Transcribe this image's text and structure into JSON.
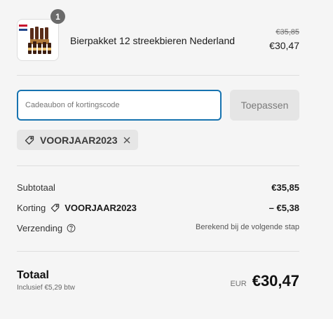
{
  "line_item": {
    "quantity": "1",
    "name": "Bierpakket 12 streekbieren Nederland",
    "original_price": "€35,85",
    "price": "€30,47",
    "thumbnail_icon": "beer-bottles-icon"
  },
  "discount": {
    "placeholder": "Cadeaubon of kortingscode",
    "apply_label": "Toepassen",
    "applied_code": "VOORJAAR2023",
    "tag_icon": "tag-icon",
    "remove_icon": "close-icon"
  },
  "summary": {
    "subtotal_label": "Subtotaal",
    "subtotal_value": "€35,85",
    "discount_label": "Korting",
    "discount_code": "VOORJAAR2023",
    "discount_value": "– €5,38",
    "shipping_label": "Verzending",
    "shipping_value": "Berekend bij de volgende stap",
    "shipping_icon": "help-circle-icon"
  },
  "total": {
    "label": "Totaal",
    "tax_note": "Inclusief €5,29 btw",
    "currency": "EUR",
    "amount": "€30,47"
  },
  "colors": {
    "focus_border": "#1773b0",
    "background": "#f5f5f5",
    "chip_background": "#e6e6e6",
    "button_disabled": "#e5e5e5"
  }
}
